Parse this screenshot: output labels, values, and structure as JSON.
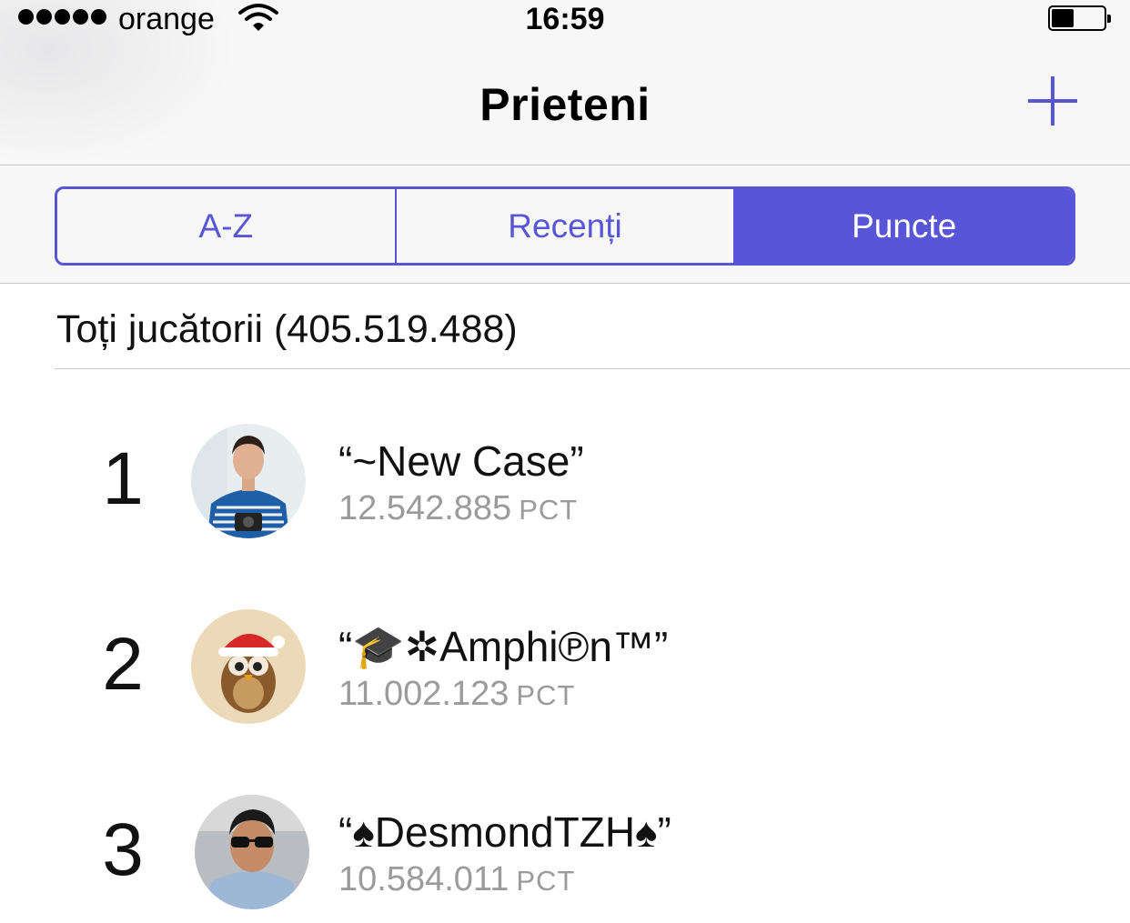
{
  "status": {
    "carrier": "orange",
    "time": "16:59",
    "signal_bars": 5
  },
  "nav": {
    "title": "Prieteni",
    "add_icon": "plus-icon"
  },
  "segments": {
    "options": [
      "A-Z",
      "Recenți",
      "Puncte"
    ],
    "selected": "Puncte"
  },
  "section": {
    "header": "Toți jucătorii (405.519.488)"
  },
  "players": [
    {
      "rank": "1",
      "name": "“~New Case”",
      "points": "12.542.885",
      "unit": "PCT"
    },
    {
      "rank": "2",
      "name": "“🎓✲Amphi℗n™”",
      "points": "11.002.123",
      "unit": "PCT"
    },
    {
      "rank": "3",
      "name": "“♠DesmondTZH♠”",
      "points": "10.584.011",
      "unit": "PCT"
    }
  ],
  "colors": {
    "accent": "#5856d6",
    "secondary_text": "#9b9b9b",
    "bar_background": "#f7f7f7"
  }
}
